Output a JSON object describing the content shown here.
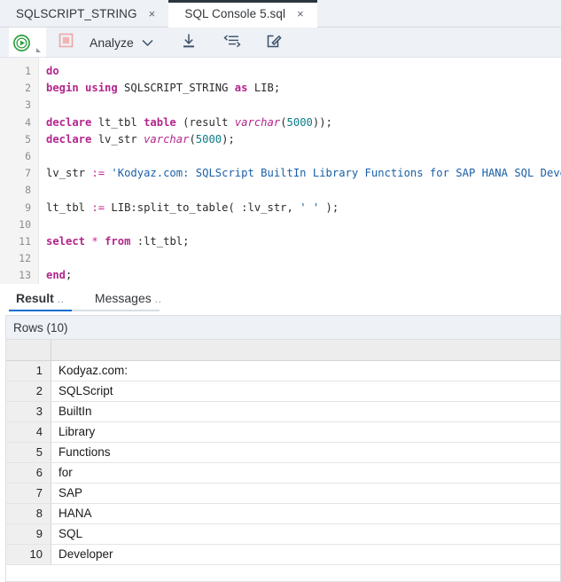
{
  "tabs": [
    {
      "label": "SQLSCRIPT_STRING",
      "close": "×",
      "active": false
    },
    {
      "label": "SQL Console 5.sql",
      "close": "×",
      "active": true
    }
  ],
  "toolbar": {
    "run_icon": "run-play-icon",
    "stop_icon": "stop-icon",
    "analyze_label": "Analyze",
    "analyze_caret": "⌄",
    "download_icon": "download-icon",
    "format_icon": "format-code-icon",
    "edit_icon": "edit-icon"
  },
  "editor": {
    "line_numbers": [
      "1",
      "2",
      "3",
      "4",
      "5",
      "6",
      "7",
      "8",
      "9",
      "10",
      "11",
      "12",
      "13"
    ],
    "lines": [
      [
        {
          "t": "do",
          "c": "kw"
        }
      ],
      [
        {
          "t": "begin using",
          "c": "kw"
        },
        {
          "t": " SQLSCRIPT_STRING ",
          "c": "pln"
        },
        {
          "t": "as",
          "c": "kw"
        },
        {
          "t": " LIB;",
          "c": "pln"
        }
      ],
      [],
      [
        {
          "t": "declare",
          "c": "kw"
        },
        {
          "t": " lt_tbl ",
          "c": "pln"
        },
        {
          "t": "table",
          "c": "kw"
        },
        {
          "t": " (result ",
          "c": "pln"
        },
        {
          "t": "varchar",
          "c": "typ"
        },
        {
          "t": "(",
          "c": "punc"
        },
        {
          "t": "5000",
          "c": "num"
        },
        {
          "t": "));",
          "c": "punc"
        }
      ],
      [
        {
          "t": "declare",
          "c": "kw"
        },
        {
          "t": " lv_str ",
          "c": "pln"
        },
        {
          "t": "varchar",
          "c": "typ"
        },
        {
          "t": "(",
          "c": "punc"
        },
        {
          "t": "5000",
          "c": "num"
        },
        {
          "t": ");",
          "c": "punc"
        }
      ],
      [],
      [
        {
          "t": "lv_str ",
          "c": "pln"
        },
        {
          "t": ":=",
          "c": "op"
        },
        {
          "t": " 'Kodyaz.com: SQLScript BuiltIn Library Functions for SAP HANA SQL Developer'",
          "c": "str"
        },
        {
          "t": ";",
          "c": "punc"
        }
      ],
      [],
      [
        {
          "t": "lt_tbl ",
          "c": "pln"
        },
        {
          "t": ":=",
          "c": "op"
        },
        {
          "t": " LIB:split_to_table( :lv_str, ",
          "c": "pln"
        },
        {
          "t": "' '",
          "c": "str"
        },
        {
          "t": " );",
          "c": "pln"
        }
      ],
      [],
      [
        {
          "t": "select",
          "c": "kw"
        },
        {
          "t": " ",
          "c": "pln"
        },
        {
          "t": "*",
          "c": "op"
        },
        {
          "t": " ",
          "c": "pln"
        },
        {
          "t": "from",
          "c": "kw"
        },
        {
          "t": " :lt_tbl",
          "c": "pln"
        },
        {
          "t": ";",
          "c": "punc"
        }
      ],
      [],
      [
        {
          "t": "end",
          "c": "kw"
        },
        {
          "t": ";",
          "c": "punc"
        }
      ]
    ]
  },
  "result": {
    "tabs": [
      {
        "label": "Result",
        "dots": "..",
        "active": true
      },
      {
        "label": "Messages",
        "dots": "..",
        "active": false
      }
    ],
    "rows_header": "Rows (10)",
    "columns": [
      "",
      ""
    ],
    "rows": [
      {
        "n": "1",
        "value": "Kodyaz.com:"
      },
      {
        "n": "2",
        "value": "SQLScript"
      },
      {
        "n": "3",
        "value": "BuiltIn"
      },
      {
        "n": "4",
        "value": "Library"
      },
      {
        "n": "5",
        "value": "Functions"
      },
      {
        "n": "6",
        "value": "for"
      },
      {
        "n": "7",
        "value": "SAP"
      },
      {
        "n": "8",
        "value": "HANA"
      },
      {
        "n": "9",
        "value": "SQL"
      },
      {
        "n": "10",
        "value": "Developer"
      }
    ]
  },
  "colors": {
    "accent": "#0a6ed1",
    "tabbar_bg": "#eef1f5",
    "run_green": "#2f9e3f",
    "stop_red": "#eda5a8",
    "keyword": "#b3268c",
    "string": "#1a5fa8",
    "number": "#0b7b86",
    "active_tab_border": "#2b3540"
  }
}
